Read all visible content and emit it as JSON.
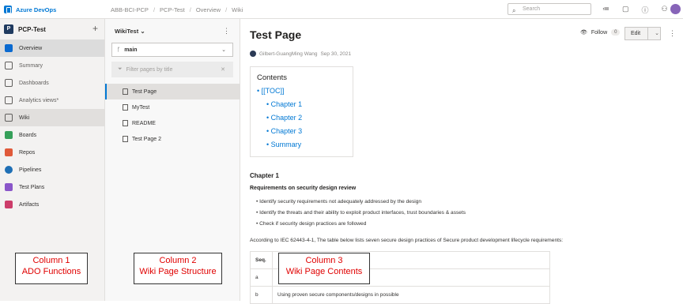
{
  "topbar": {
    "brand": "Azure DevOps",
    "breadcrumbs": [
      "ABB-BCI-PCP",
      "PCP-Test",
      "Overview",
      "Wiki"
    ],
    "search_placeholder": "Search"
  },
  "sidebar": {
    "project_badge": "P",
    "project_name": "PCP-Test",
    "items": [
      {
        "label": "Overview",
        "icon": "overview-icon"
      },
      {
        "label": "Summary",
        "icon": "summary-icon"
      },
      {
        "label": "Dashboards",
        "icon": "dashboards-icon"
      },
      {
        "label": "Analytics views*",
        "icon": "analytics-icon"
      },
      {
        "label": "Wiki",
        "icon": "wiki-icon"
      },
      {
        "label": "Boards",
        "icon": "boards-icon"
      },
      {
        "label": "Repos",
        "icon": "repos-icon"
      },
      {
        "label": "Pipelines",
        "icon": "pipelines-icon"
      },
      {
        "label": "Test Plans",
        "icon": "test-plans-icon"
      },
      {
        "label": "Artifacts",
        "icon": "artifacts-icon"
      }
    ]
  },
  "wiki_tree": {
    "wiki_name": "WikiTest",
    "branch": "main",
    "filter_placeholder": "Filter pages by title",
    "pages": [
      "Test Page",
      "MyTest",
      "README",
      "Test Page 2"
    ]
  },
  "page": {
    "title": "Test Page",
    "author": "Gilbert-GuangMing Wang",
    "date": "Sep 30, 2021",
    "follow_label": "Follow",
    "follow_count": "0",
    "edit_label": "Edit",
    "toc_title": "Contents",
    "toc": [
      {
        "text": "[[TOC]]",
        "level": 1
      },
      {
        "text": "Chapter 1",
        "level": 2
      },
      {
        "text": "Chapter 2",
        "level": 2
      },
      {
        "text": "Chapter 3",
        "level": 2
      },
      {
        "text": "Summary",
        "level": 2
      }
    ],
    "chapter_heading": "Chapter 1",
    "section_heading": "Requirements on security design review",
    "bullets": [
      "Identify security requirements not adequately addressed by the design",
      "Identify the threats and their ability to exploit product interfaces, trust boundaries & assets",
      "Check if security design practices are followed"
    ],
    "paragraph": "According to IEC 62443-4-1, The table below lists seven secure design practices of Secure product development lifecycle requirements:",
    "table_header": "Seq.",
    "table_rows": [
      {
        "seq": "a",
        "text": ""
      },
      {
        "seq": "b",
        "text": "Using proven secure components/designs in possible"
      }
    ]
  },
  "annotations": {
    "col1": [
      "Column 1",
      "ADO Functions"
    ],
    "col2": [
      "Column 2",
      "Wiki Page Structure"
    ],
    "col3": [
      "Column 3",
      "Wiki Page Contents"
    ]
  }
}
